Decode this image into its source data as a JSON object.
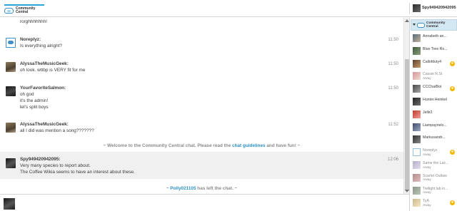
{
  "header": {
    "logo_text": "Community\nCentral",
    "current_user": "Spy949420942095"
  },
  "chat": {
    "messages": [
      {
        "user": "",
        "lines": [
          "rorghhhhhhh!"
        ],
        "time": ""
      },
      {
        "user": "Noreplyz:",
        "lines": [
          "Is everything alright?"
        ],
        "time": "11:50"
      },
      {
        "user": "AlyssaTheMusicGeek:",
        "lines": [
          "oh look. wttbp is VERY fit for me"
        ],
        "time": "11:50"
      },
      {
        "user": "YourFavoriteSalmon:",
        "lines": [
          "oh god",
          "it's the admin!",
          "let's split boys"
        ],
        "time": "11:50"
      },
      {
        "user": "AlyssaTheMusicGeek:",
        "lines": [
          "all I did was mention a song???????"
        ],
        "time": "11:52"
      },
      {
        "user": "Spy949420942095:",
        "lines": [
          "Very many species to report about.",
          "The Coffee Wikia seems to have an interest about these."
        ],
        "time": "12:06"
      }
    ],
    "welcome": {
      "prefix": "~ Welcome to the Community Central chat. Please read the ",
      "link": "chat guidelines",
      "suffix": " and have fun! ~"
    },
    "left_notice": {
      "prefix": "~ ",
      "user": "Polly021105",
      "suffix": " has left the chat. ~"
    }
  },
  "sidebar": {
    "room_label": "Community\nCentral",
    "users": [
      {
        "name": "Annabeth an...",
        "status": "",
        "star": false,
        "away": false
      },
      {
        "name": "Blue Tree Ro...",
        "status": "",
        "star": false,
        "away": false
      },
      {
        "name": "Callofduty4",
        "status": "",
        "star": true,
        "away": false
      },
      {
        "name": "Cassie R.St",
        "status": "Away",
        "star": false,
        "away": true
      },
      {
        "name": "CCChatBot",
        "status": "",
        "star": true,
        "away": false
      },
      {
        "name": "Hunter.Heinkel",
        "status": "",
        "star": false,
        "away": false
      },
      {
        "name": "Jellir2",
        "status": "",
        "star": false,
        "away": false
      },
      {
        "name": "Liampaynelo...",
        "status": "",
        "star": false,
        "away": false
      },
      {
        "name": "Markusandr...",
        "status": "",
        "star": false,
        "away": false
      },
      {
        "name": "Noreplyz",
        "status": "Away",
        "star": true,
        "away": true
      },
      {
        "name": "Same the Laz...",
        "status": "Away",
        "star": false,
        "away": true
      },
      {
        "name": "Scarlet Outlaw",
        "status": "Away",
        "star": false,
        "away": true
      },
      {
        "name": "Twilight lab in...",
        "status": "Away",
        "star": false,
        "away": true
      },
      {
        "name": "TyA",
        "status": "Away",
        "star": true,
        "away": true
      }
    ]
  },
  "input": {
    "placeholder": ""
  },
  "colors": {
    "accent": "#2a8fc4",
    "star": "#f2b700",
    "header_rule": "#2aa6d8"
  }
}
